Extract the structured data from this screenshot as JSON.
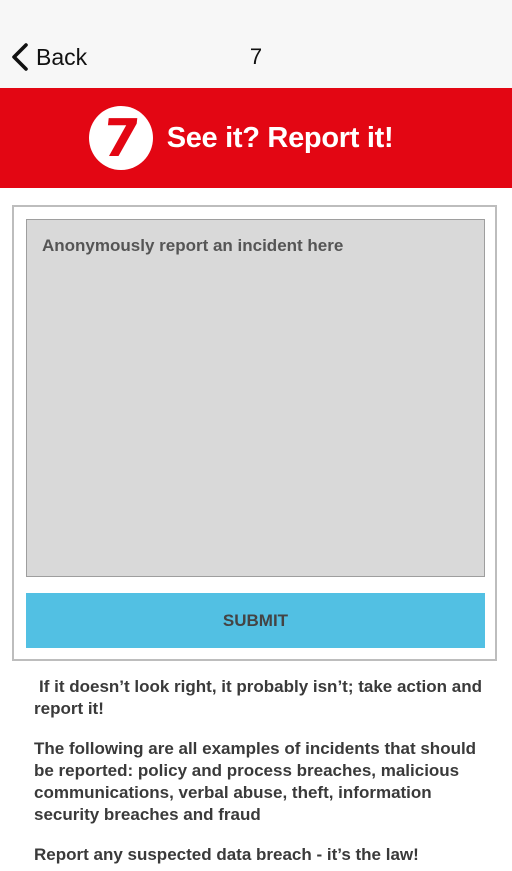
{
  "nav": {
    "back_label": "Back",
    "title": "7"
  },
  "banner": {
    "logo_number": "7",
    "slogan": "See it? Report it!"
  },
  "form": {
    "placeholder": "Anonymously report an incident here",
    "submit_label": "SUBMIT"
  },
  "info": {
    "paragraphs": [
      "If it doesn’t look right, it probably isn’t; take action and report it!",
      "The following are all examples of incidents that should be reported: policy and process breaches, malicious communications, verbal abuse, theft, information security breaches and fraud",
      "Report any suspected data breach - it’s the law!"
    ]
  },
  "colors": {
    "brand_red": "#e30613",
    "submit_blue": "#52c0e3",
    "textarea_gray": "#d9d9d9"
  },
  "icons": {
    "back": "chevron-left-icon",
    "logo": "seven-logo-icon"
  }
}
